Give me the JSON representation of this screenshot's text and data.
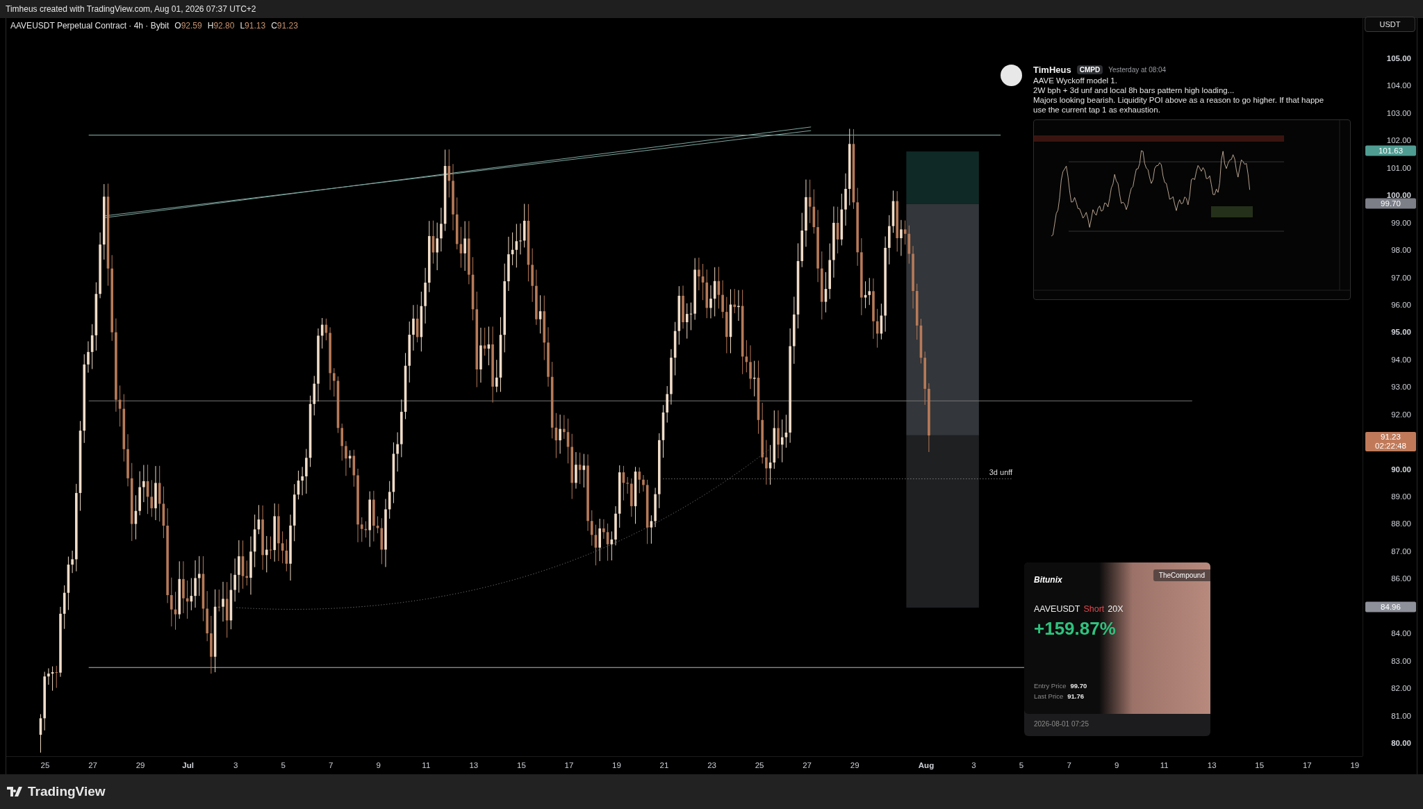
{
  "header": {
    "caption": "Timheus created with TradingView.com, Aug 01, 2026 07:37 UTC+2"
  },
  "legend": {
    "symbol": "AAVEUSDT Perpetual Contract · 4h · Bybit",
    "ohlc": [
      {
        "key": "O",
        "value": "92.59"
      },
      {
        "key": "H",
        "value": "92.80"
      },
      {
        "key": "L",
        "value": "91.13"
      },
      {
        "key": "C",
        "value": "91.23"
      }
    ]
  },
  "currency_button": "USDT",
  "price_scale": [
    {
      "label": "105.00",
      "major": true
    },
    {
      "label": "104.00",
      "major": false
    },
    {
      "label": "103.00",
      "major": false
    },
    {
      "label": "102.00",
      "major": false
    },
    {
      "label": "101.00",
      "major": false
    },
    {
      "label": "100.00",
      "major": true
    },
    {
      "label": "99.00",
      "major": false
    },
    {
      "label": "98.00",
      "major": false
    },
    {
      "label": "97.00",
      "major": false
    },
    {
      "label": "96.00",
      "major": false
    },
    {
      "label": "95.00",
      "major": true
    },
    {
      "label": "94.00",
      "major": false
    },
    {
      "label": "93.00",
      "major": false
    },
    {
      "label": "92.00",
      "major": false
    },
    {
      "label": "90.00",
      "major": true
    },
    {
      "label": "89.00",
      "major": false
    },
    {
      "label": "88.00",
      "major": false
    },
    {
      "label": "87.00",
      "major": false
    },
    {
      "label": "86.00",
      "major": false
    },
    {
      "label": "84.00",
      "major": false
    },
    {
      "label": "83.00",
      "major": false
    },
    {
      "label": "82.00",
      "major": false
    },
    {
      "label": "81.00",
      "major": false
    },
    {
      "label": "80.00",
      "major": true
    }
  ],
  "price_tags": [
    {
      "label": "101.63",
      "color": "#4f9c92"
    },
    {
      "label": "99.70",
      "color": "#7c7f88"
    },
    {
      "label": "91.23",
      "countdown": "02:22:48",
      "color": "#c07a5a"
    },
    {
      "label": "84.96",
      "color": "#8e919a"
    }
  ],
  "time_scale": [
    {
      "label": "25",
      "major": false
    },
    {
      "label": "27",
      "major": false
    },
    {
      "label": "29",
      "major": false
    },
    {
      "label": "Jul",
      "major": true
    },
    {
      "label": "3",
      "major": false
    },
    {
      "label": "5",
      "major": false
    },
    {
      "label": "7",
      "major": false
    },
    {
      "label": "9",
      "major": false
    },
    {
      "label": "11",
      "major": false
    },
    {
      "label": "13",
      "major": false
    },
    {
      "label": "15",
      "major": false
    },
    {
      "label": "17",
      "major": false
    },
    {
      "label": "19",
      "major": false
    },
    {
      "label": "21",
      "major": false
    },
    {
      "label": "23",
      "major": false
    },
    {
      "label": "25",
      "major": false
    },
    {
      "label": "27",
      "major": false
    },
    {
      "label": "29",
      "major": false
    },
    {
      "label": "Aug",
      "major": true
    },
    {
      "label": "3",
      "major": false
    },
    {
      "label": "5",
      "major": false
    },
    {
      "label": "7",
      "major": false
    },
    {
      "label": "9",
      "major": false
    },
    {
      "label": "11",
      "major": false
    },
    {
      "label": "13",
      "major": false
    },
    {
      "label": "15",
      "major": false
    },
    {
      "label": "17",
      "major": false
    },
    {
      "label": "19",
      "major": false
    }
  ],
  "drawing_label": "3d unff",
  "comment": {
    "author": "TimHeus",
    "badge": "CMPD",
    "time": "Yesterday at 08:04",
    "lines": [
      "AAVE Wyckoff model 1.",
      "2W bph + 3d unf and local 8h bars pattern high loading...",
      "Majors looking bearish. Liquidity POI above as a reason to go higher. If that happe",
      "use the current tap 1 as exhaustion."
    ]
  },
  "share_card": {
    "exchange": "Bitunix",
    "community": "TheCompound",
    "symbol": "AAVEUSDT",
    "side": "Short",
    "leverage": "20X",
    "pnl": "+159.87%",
    "fields": [
      {
        "label": "Entry Price",
        "value": "99.70"
      },
      {
        "label": "Last Price",
        "value": "91.76"
      }
    ],
    "timestamp": "2026-08-01 07:25"
  },
  "footer": {
    "brand": "TradingView"
  }
}
